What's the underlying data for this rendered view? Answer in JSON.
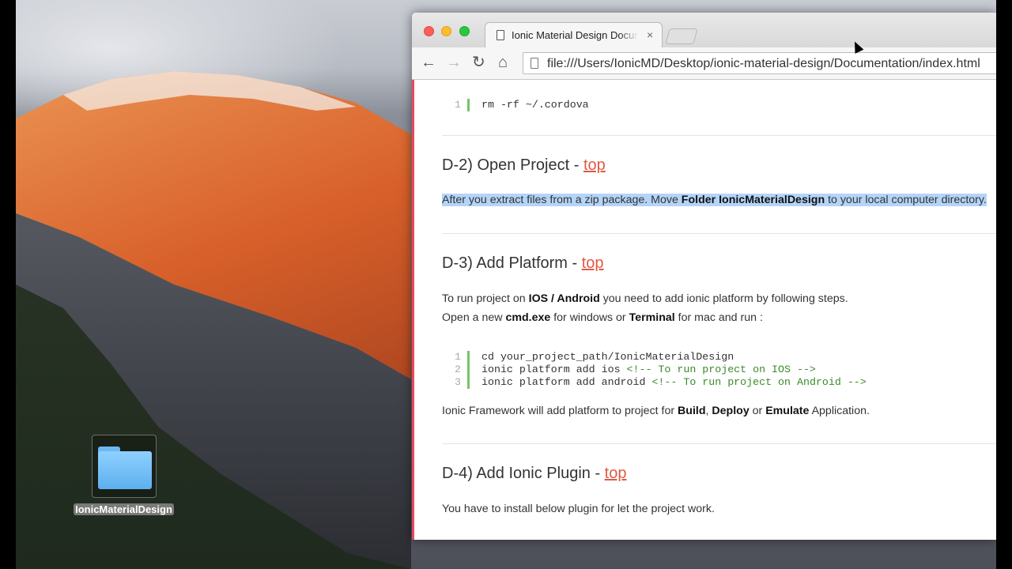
{
  "desktop": {
    "folder_label": "IonicMaterialDesign"
  },
  "browser": {
    "tab_title": "Ionic Material Design Documentation",
    "tab_close": "×",
    "url": "file:///Users/IonicMD/Desktop/ionic-material-design/Documentation/index.html"
  },
  "content": {
    "code1": [
      {
        "ln": "1",
        "text": "rm -rf ~/.cordova",
        "comment": ""
      }
    ],
    "d2": {
      "title": "D-2) Open Project - ",
      "top_link": "top",
      "para_pre": "After you extract files from a zip package. Move ",
      "para_bold": "Folder IonicMaterialDesign",
      "para_post": " to your local computer directory."
    },
    "d3": {
      "title": "D-3) Add Platform - ",
      "top_link": "top",
      "line1_pre": "To run project on ",
      "line1_bold": "IOS / Android",
      "line1_post": " you need to add ionic platform by following steps.",
      "line2_pre": "Open a new ",
      "line2_bold1": "cmd.exe",
      "line2_mid": " for windows or ",
      "line2_bold2": "Terminal",
      "line2_post": " for mac and run :",
      "code": [
        {
          "ln": "1",
          "text": "cd your_project_path/IonicMaterialDesign",
          "comment": ""
        },
        {
          "ln": "2",
          "text": "ionic platform add ios ",
          "comment": "<!-- To run project on IOS -->"
        },
        {
          "ln": "3",
          "text": "ionic platform add android ",
          "comment": "<!-- To run project on Android -->"
        }
      ],
      "footer_pre": "Ionic Framework will add platform to project for ",
      "footer_b1": "Build",
      "footer_sep1": ", ",
      "footer_b2": "Deploy",
      "footer_sep2": " or ",
      "footer_b3": "Emulate",
      "footer_post": " Application."
    },
    "d4": {
      "title": "D-4) Add Ionic Plugin - ",
      "top_link": "top",
      "para": "You have to install below plugin for let the project work."
    }
  }
}
